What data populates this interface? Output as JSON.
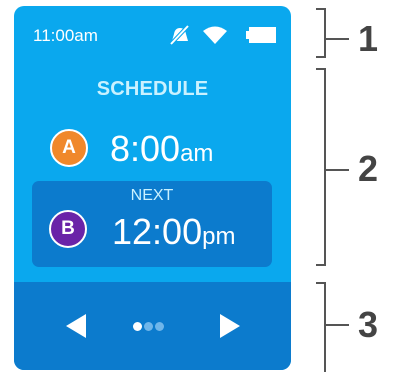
{
  "status_bar": {
    "time": "11:00am",
    "icons": [
      "notifications-off-icon",
      "wifi-icon",
      "battery-icon"
    ]
  },
  "schedule": {
    "title": "SCHEDULE",
    "current": {
      "badge": "A",
      "time": "8:00",
      "ampm": "am"
    },
    "next": {
      "label": "NEXT",
      "badge": "B",
      "time": "12:00",
      "ampm": "pm"
    }
  },
  "navigation": {
    "prev_icon": "previous-arrow-icon",
    "next_icon": "next-arrow-icon",
    "page_count": 3,
    "active_page": 1
  },
  "callouts": [
    {
      "label": "1"
    },
    {
      "label": "2"
    },
    {
      "label": "3"
    }
  ],
  "colors": {
    "screen_bg": "#0aa8ee",
    "panel_bg": "#0c7bcd",
    "title_text": "#c9f1ff",
    "badge_a": "#f0882b",
    "badge_b": "#6a23a8",
    "callout": "#444444"
  }
}
